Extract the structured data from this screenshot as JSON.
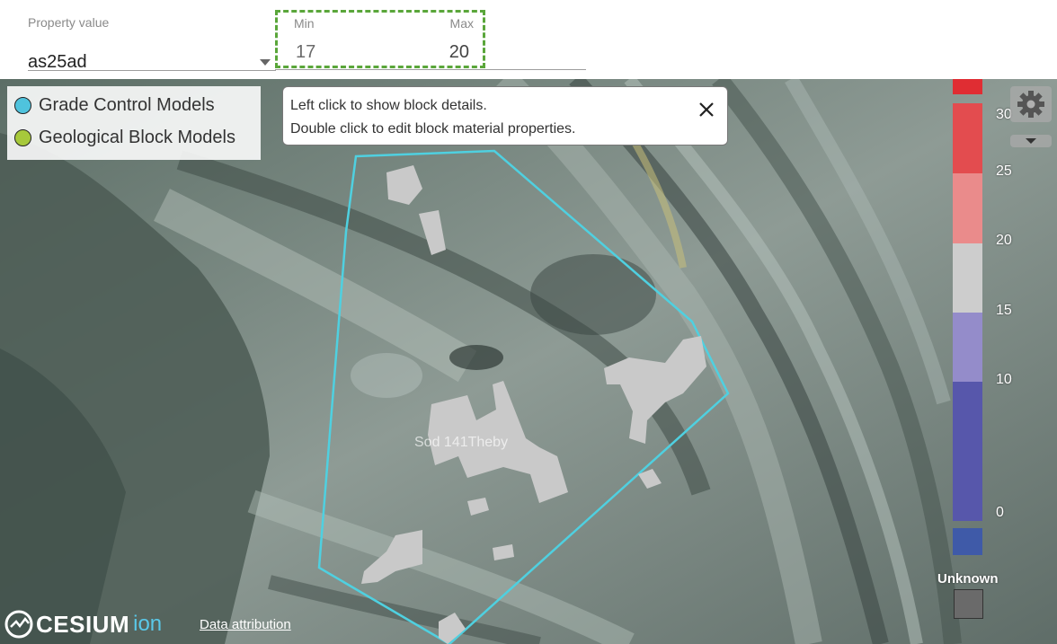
{
  "property": {
    "label": "Property value",
    "value": "as25ad"
  },
  "range": {
    "min_label": "Min",
    "max_label": "Max",
    "min_value": "17",
    "max_value": "20"
  },
  "legend": {
    "items": [
      {
        "label": "Grade Control Models",
        "color": "#4fc3dd"
      },
      {
        "label": "Geological Block Models",
        "color": "#a7c93b"
      }
    ]
  },
  "tooltip": {
    "line1": "Left click to show block details.",
    "line2": "Double click to edit block material properties.",
    "close_icon": "close-icon"
  },
  "map": {
    "block_label": "Sod          141Theby",
    "boundary_color": "#4fd0e0",
    "block_color": "#c9c9c9"
  },
  "color_ramp": {
    "ticks": [
      "30",
      "25",
      "20",
      "15",
      "10",
      "0"
    ],
    "segments": [
      {
        "from": 25,
        "to": 30,
        "color": "#e34c4f"
      },
      {
        "from": 20,
        "to": 25,
        "color": "#ea8b8b"
      },
      {
        "from": 15,
        "to": 20,
        "color": "#cdcdcd"
      },
      {
        "from": 10,
        "to": 15,
        "color": "#948cca"
      },
      {
        "from": 0,
        "to": 10,
        "color": "#5757ab"
      }
    ],
    "above_color": "#e02d33",
    "below_color": "#3f5aa8",
    "unknown_label": "Unknown",
    "unknown_color": "#6a6a6a"
  },
  "controls": {
    "settings_icon": "gear-icon",
    "dropdown_icon": "chevron-down-icon"
  },
  "footer": {
    "brand": "CESIUM",
    "brand_suffix": "ion",
    "attribution": "Data attribution"
  }
}
